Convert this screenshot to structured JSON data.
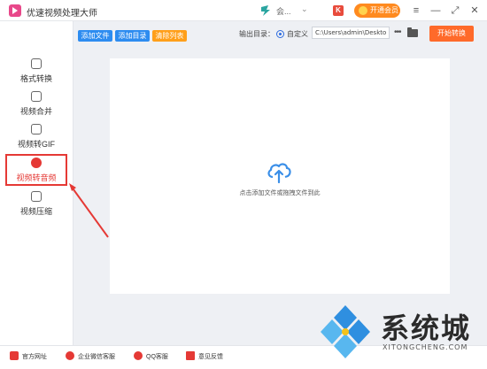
{
  "app": {
    "title": "优速视频处理大师"
  },
  "titlebar": {
    "user_name": "会...",
    "user_caret": "⌄",
    "promo_glyph": "K",
    "vip_label": "开通会员",
    "menu_glyph": "≡",
    "minimize_glyph": "—",
    "maximize_glyph": "⤢",
    "close_glyph": "✕"
  },
  "toolbar": {
    "add_file": "添加文件",
    "add_folder": "添加目录",
    "clear_list": "清除列表",
    "output_dir_label": "输出目录：",
    "custom_label": "自定义",
    "output_path": "C:\\Users\\admin\\Deskto",
    "more": "•••",
    "start": "开始转换"
  },
  "sidebar": {
    "items": [
      {
        "label": "格式转换",
        "icon": "format-convert-icon",
        "active": false
      },
      {
        "label": "视频合并",
        "icon": "video-merge-icon",
        "active": false
      },
      {
        "label": "视频转GIF",
        "icon": "gif-icon",
        "active": false
      },
      {
        "label": "视频转音频",
        "icon": "audio-icon",
        "active": true
      },
      {
        "label": "视频压缩",
        "icon": "compress-icon",
        "active": false
      }
    ]
  },
  "drop_zone": {
    "hint": "点击添加文件或拖拽文件到此"
  },
  "footer": {
    "links": [
      {
        "label": "官方网址",
        "icon": "website-icon",
        "color": "#e53935"
      },
      {
        "label": "企业微信客服",
        "icon": "wechat-service-icon",
        "color": "#e53935"
      },
      {
        "label": "QQ客服",
        "icon": "qq-icon",
        "color": "#e53935"
      },
      {
        "label": "意见反馈",
        "icon": "feedback-icon",
        "color": "#e53935"
      }
    ]
  },
  "watermark": {
    "text": "系统城",
    "sub": "XITONGCHENG.COM"
  },
  "colors": {
    "accent_blue": "#2d8cf0",
    "clear_orange": "#ff9f1a",
    "start_orange": "#ff6a2a",
    "highlight_red": "#e53935",
    "upload_blue": "#3b8fe8"
  }
}
